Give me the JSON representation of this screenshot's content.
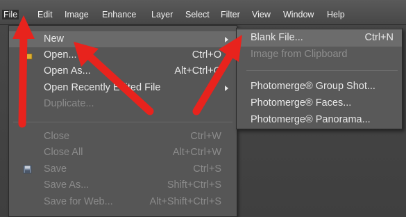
{
  "menubar": {
    "items": [
      "File",
      "Edit",
      "Image",
      "Enhance",
      "Layer",
      "Select",
      "Filter",
      "View",
      "Window",
      "Help"
    ]
  },
  "file_menu": {
    "items": [
      {
        "label": "New",
        "shortcut": "",
        "has_submenu": true,
        "enabled": true,
        "highlighted": true
      },
      {
        "label": "Open...",
        "shortcut": "Ctrl+O",
        "has_submenu": false,
        "enabled": true,
        "icon": "folder-icon"
      },
      {
        "label": "Open As...",
        "shortcut": "Alt+Ctrl+O",
        "has_submenu": false,
        "enabled": true
      },
      {
        "label": "Open Recently Edited File",
        "shortcut": "",
        "has_submenu": true,
        "enabled": true
      },
      {
        "label": "Duplicate...",
        "shortcut": "",
        "has_submenu": false,
        "enabled": false
      },
      {
        "label": "Close",
        "shortcut": "Ctrl+W",
        "has_submenu": false,
        "enabled": false
      },
      {
        "label": "Close All",
        "shortcut": "Alt+Ctrl+W",
        "has_submenu": false,
        "enabled": false
      },
      {
        "label": "Save",
        "shortcut": "Ctrl+S",
        "has_submenu": false,
        "enabled": false,
        "icon": "floppy-disk-icon"
      },
      {
        "label": "Save As...",
        "shortcut": "Shift+Ctrl+S",
        "has_submenu": false,
        "enabled": false
      },
      {
        "label": "Save for Web...",
        "shortcut": "Alt+Shift+Ctrl+S",
        "has_submenu": false,
        "enabled": false
      }
    ]
  },
  "new_submenu": {
    "items": [
      {
        "label": "Blank File...",
        "shortcut": "Ctrl+N",
        "enabled": true,
        "highlighted": true
      },
      {
        "label": "Image from Clipboard",
        "shortcut": "",
        "enabled": false
      },
      {
        "label": "Photomerge® Group Shot...",
        "shortcut": "",
        "enabled": true
      },
      {
        "label": "Photomerge® Faces...",
        "shortcut": "",
        "enabled": true
      },
      {
        "label": "Photomerge® Panorama...",
        "shortcut": "",
        "enabled": true
      }
    ]
  },
  "colors": {
    "arrow": "#e8231d",
    "menu_bg": "#565656",
    "highlight": "#6a6a6a",
    "text": "#e8e8e8",
    "disabled_text": "#8b8b8b"
  }
}
